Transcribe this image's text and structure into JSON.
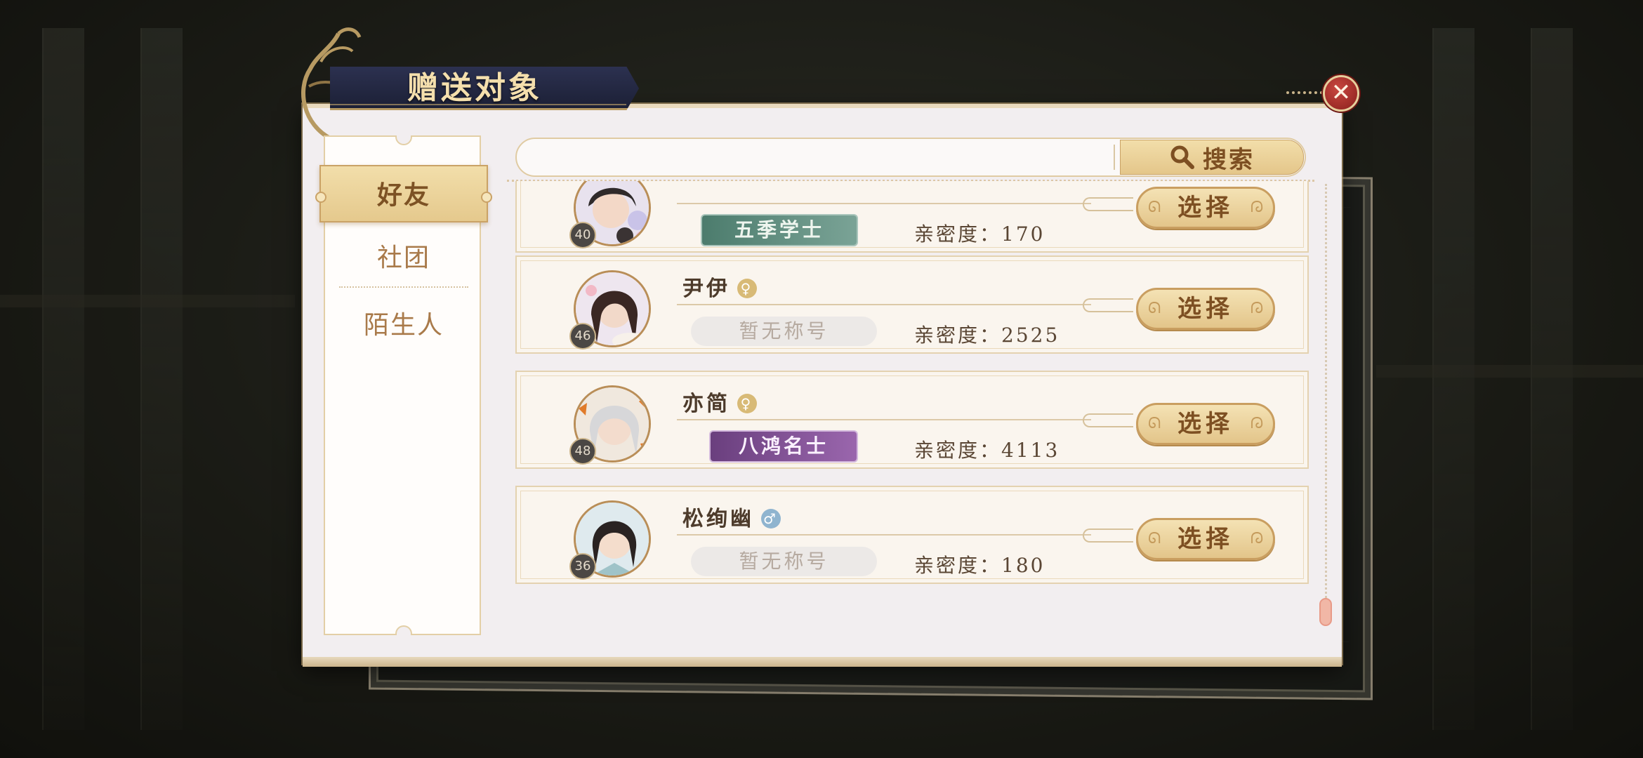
{
  "dialog": {
    "title": "赠送对象",
    "close_label": "✕"
  },
  "sidebar": {
    "tabs": [
      {
        "label": "好友",
        "active": true
      },
      {
        "label": "社团",
        "active": false
      },
      {
        "label": "陌生人",
        "active": false
      }
    ]
  },
  "search": {
    "placeholder": "",
    "value": "",
    "button_label": "搜索"
  },
  "friends": [
    {
      "name": "",
      "gender": "",
      "level": "40",
      "title": "五季学士",
      "title_style": "green",
      "affinity_label": "亲密度：",
      "affinity": "170",
      "select_label": "选择"
    },
    {
      "name": "尹伊",
      "gender": "female",
      "gender_symbol": "♀",
      "level": "46",
      "title": "暂无称号",
      "title_style": "none",
      "affinity_label": "亲密度：",
      "affinity": "2525",
      "select_label": "选择"
    },
    {
      "name": "亦简",
      "gender": "female",
      "gender_symbol": "♀",
      "level": "48",
      "title": "八鸿名士",
      "title_style": "purple",
      "affinity_label": "亲密度：",
      "affinity": "4113",
      "select_label": "选择"
    },
    {
      "name": "松绚幽",
      "gender": "male",
      "gender_symbol": "♂",
      "level": "36",
      "title": "暂无称号",
      "title_style": "none",
      "affinity_label": "亲密度：",
      "affinity": "180",
      "select_label": "选择"
    }
  ],
  "colors": {
    "accent_gold": "#e4c68a",
    "close_red": "#8a1f1c",
    "banner_navy": "#1c2036"
  }
}
